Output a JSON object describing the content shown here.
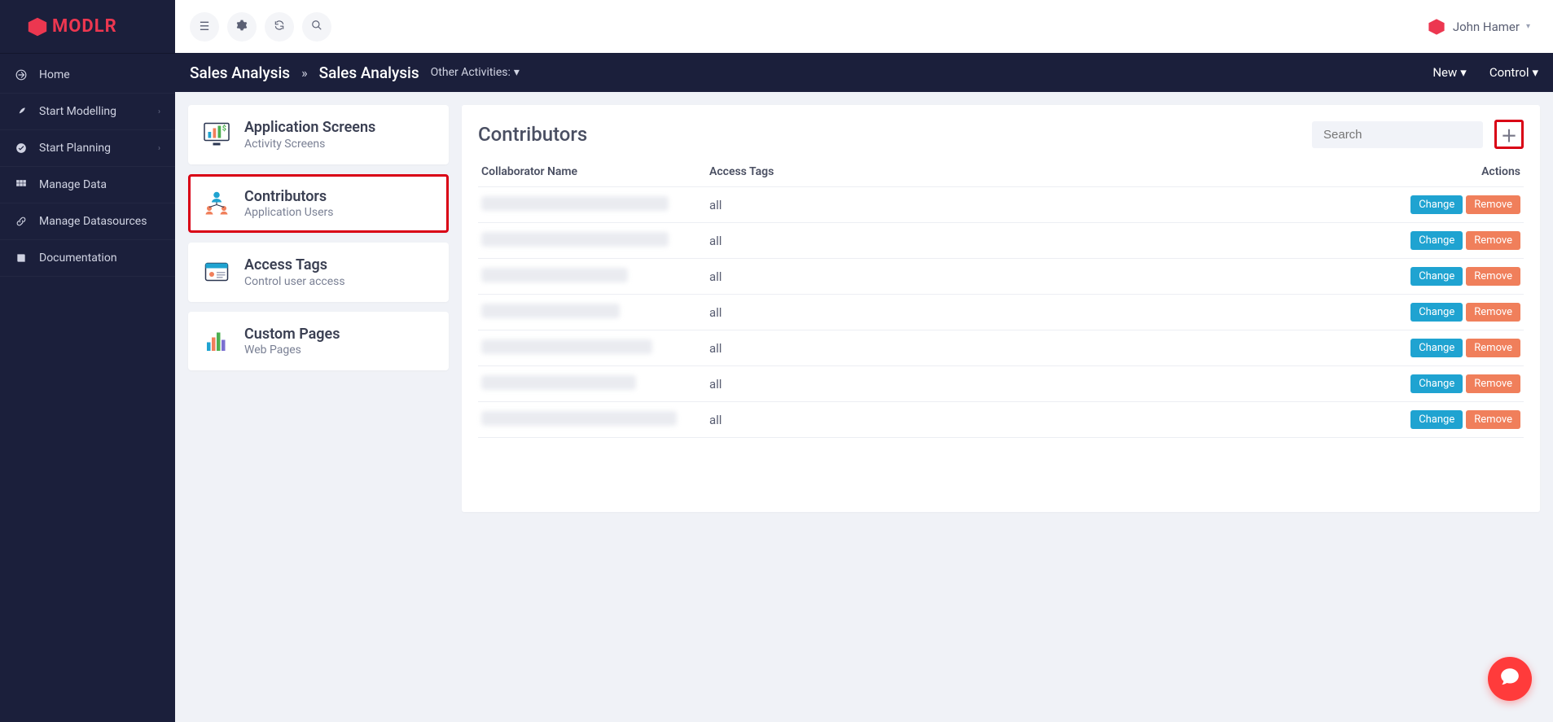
{
  "brand": "MODLR",
  "user": {
    "name": "John Hamer"
  },
  "topbar": {
    "menu_icon": "☰",
    "gear_icon": "⚙",
    "refresh_icon": "↻",
    "search_icon": "🔍"
  },
  "sidebar": {
    "items": [
      {
        "label": "Home",
        "icon": "arrow-out",
        "caret": false
      },
      {
        "label": "Start Modelling",
        "icon": "rocket",
        "caret": true
      },
      {
        "label": "Start Planning",
        "icon": "check",
        "caret": true
      },
      {
        "label": "Manage Data",
        "icon": "grid",
        "caret": false
      },
      {
        "label": "Manage Datasources",
        "icon": "link",
        "caret": false
      },
      {
        "label": "Documentation",
        "icon": "book",
        "caret": false
      }
    ]
  },
  "breadcrumb": {
    "root": "Sales Analysis",
    "current": "Sales Analysis",
    "other_label": "Other Activities:",
    "new_label": "New",
    "control_label": "Control"
  },
  "tabs": [
    {
      "title": "Application Screens",
      "sub": "Activity Screens"
    },
    {
      "title": "Contributors",
      "sub": "Application Users"
    },
    {
      "title": "Access Tags",
      "sub": "Control user access"
    },
    {
      "title": "Custom Pages",
      "sub": "Web Pages"
    }
  ],
  "panel": {
    "title": "Contributors",
    "search_placeholder": "Search",
    "columns": {
      "name": "Collaborator Name",
      "tags": "Access Tags",
      "actions": "Actions"
    },
    "change_label": "Change",
    "remove_label": "Remove",
    "rows": [
      {
        "name_redacted_width": 230,
        "tags": "all"
      },
      {
        "name_redacted_width": 230,
        "tags": "all"
      },
      {
        "name_redacted_width": 180,
        "tags": "all"
      },
      {
        "name_redacted_width": 170,
        "tags": "all"
      },
      {
        "name_redacted_width": 210,
        "tags": "all"
      },
      {
        "name_redacted_width": 190,
        "tags": "all"
      },
      {
        "name_redacted_width": 240,
        "tags": "all"
      }
    ]
  }
}
